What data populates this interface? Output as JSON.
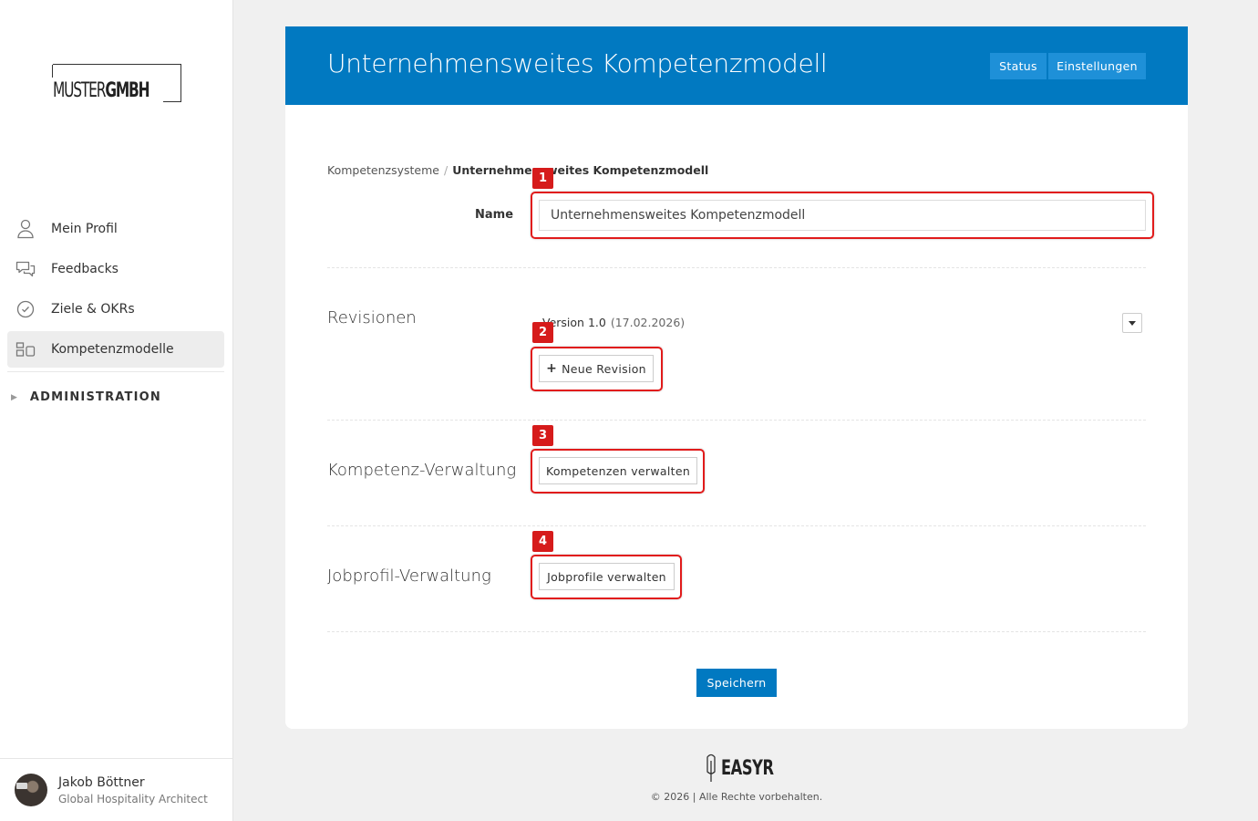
{
  "sidebar": {
    "logo": {
      "light": "MUSTER",
      "bold": "GMBH"
    },
    "items": [
      {
        "label": "Mein Profil",
        "icon": "user-icon",
        "active": false
      },
      {
        "label": "Feedbacks",
        "icon": "chat-bubbles-icon",
        "active": false
      },
      {
        "label": "Ziele & OKRs",
        "icon": "check-circle-icon",
        "active": false
      },
      {
        "label": "Kompetenzmodelle",
        "icon": "competence-model-icon",
        "active": true
      }
    ],
    "admin_label": "ADMINISTRATION",
    "user": {
      "name": "Jakob Böttner",
      "role": "Global Hospitality Architect"
    }
  },
  "header": {
    "title": "Unternehmensweites Kompetenzmodell",
    "status_label": "Status",
    "settings_label": "Einstellungen",
    "color": "#0179c1"
  },
  "breadcrumb": {
    "parent": "Kompetenzsysteme",
    "separator": "/",
    "current": "Unternehmensweites Kompetenzmodell"
  },
  "form": {
    "name_label": "Name",
    "name_value": "Unternehmensweites Kompetenzmodell",
    "revisions": {
      "title": "Revisionen",
      "version": "Version 1.0",
      "date": "(17.02.2026)",
      "new_revision_label": "Neue Revision"
    },
    "competence": {
      "title": "Kompetenz-Verwaltung",
      "button_label": "Kompetenzen verwalten"
    },
    "jobprofile": {
      "title": "Jobprofil-Verwaltung",
      "button_label": "Jobprofile verwalten"
    },
    "save_label": "Speichern"
  },
  "callouts": [
    "1",
    "2",
    "3",
    "4"
  ],
  "footer": {
    "brand": "EASYR",
    "copyright": "© 2026 | Alle Rechte vorbehalten."
  },
  "colors": {
    "accent": "#0179c1",
    "callout": "#e11b1b",
    "callout_badge": "#d61b1b"
  }
}
